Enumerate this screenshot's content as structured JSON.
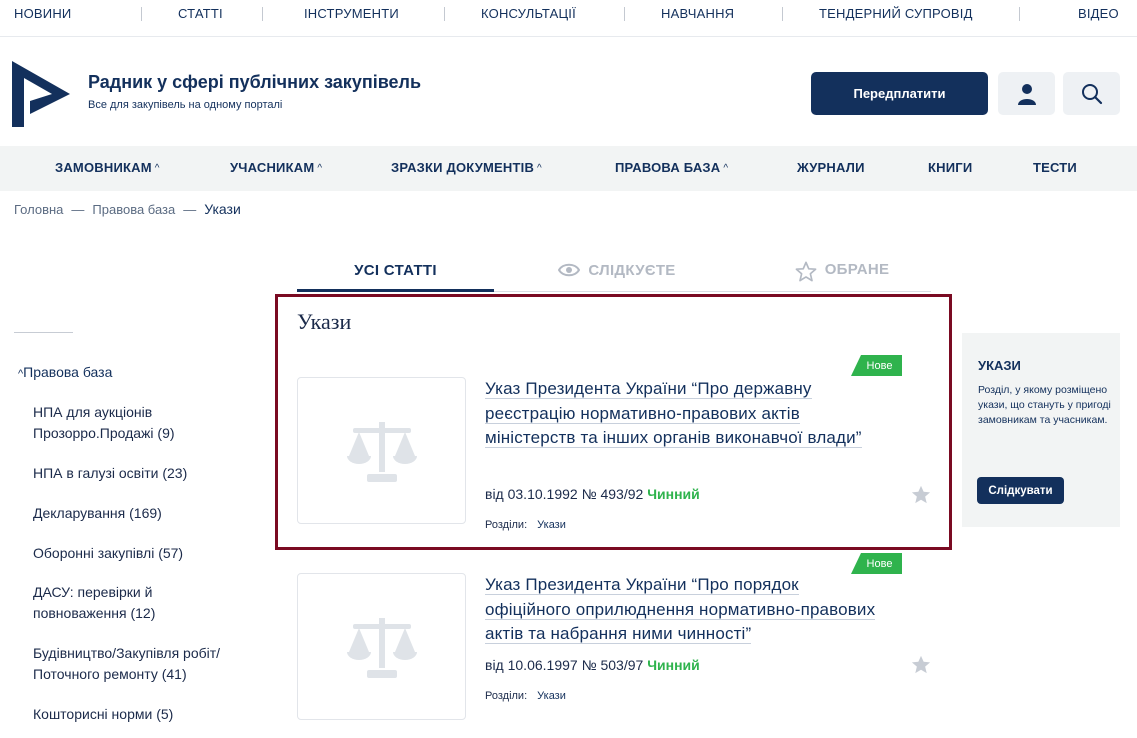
{
  "top_nav": [
    "НОВИНИ",
    "СТАТТІ",
    "ІНСТРУМЕНТИ",
    "КОНСУЛЬТАЦІЇ",
    "НАВЧАННЯ",
    "ТЕНДЕРНИЙ СУПРОВІД",
    "ВІДЕО"
  ],
  "header": {
    "title": "Радник у сфері публічних закупівель",
    "subtitle": "Все для закупівель на одному порталі",
    "subscribe_label": "Передплатити",
    "user_icon": "user-icon",
    "search_icon": "search-icon"
  },
  "main_menu": [
    "ЗАМОВНИКАМ",
    "УЧАСНИКАМ",
    "ЗРАЗКИ ДОКУМЕНТІВ",
    "ПРАВОВА БАЗА",
    "ЖУРНАЛИ",
    "КНИГИ",
    "ТЕСТИ"
  ],
  "breadcrumb": {
    "home": "Головна",
    "level1": "Правова база",
    "current": "Укази",
    "separator": "—"
  },
  "tabs": {
    "all": "УСІ СТАТТІ",
    "following": "СЛІДКУЄТЕ",
    "favorites": "ОБРАНЕ"
  },
  "sidebar": {
    "head": "Правова база",
    "items": [
      "НПА для аукціонів Прозорро.Продажі (9)",
      "НПА в галузі освіти (23)",
      "Декларування (169)",
      "Оборонні закупівлі (57)",
      "ДАСУ: перевірки й повноваження (12)",
      "Будівництво/Закупівля робіт/ Поточного ремонту (41)",
      "Кошторисні норми (5)"
    ]
  },
  "section_title": "Укази",
  "articles": [
    {
      "badge": "Нове",
      "title": "Указ Президента України “Про державну реєстрацію нормативно-правових актів міністерств та інших органів виконавчої влади”",
      "meta": "від 03.10.1992 № 493/92",
      "status": "Чинний",
      "sections_label": "Розділи:",
      "section": "Укази"
    },
    {
      "badge": "Нове",
      "title": "Указ Президента України “Про порядок офіційного оприлюднення нормативно-правових актів та набрання ними чинності”",
      "meta": "від 10.06.1997 № 503/97",
      "status": "Чинний",
      "sections_label": "Розділи:",
      "section": "Укази"
    }
  ],
  "right_panel": {
    "title": "УКАЗИ",
    "text": "Розділ, у якому розміщено укази, що стануть у пригоді замовникам та учасникам.",
    "button": "Слідкувати"
  },
  "colors": {
    "brand": "#13305c",
    "status_green": "#2fb34d",
    "highlight": "#7a0a22",
    "menu_bg": "#f2f4f4"
  }
}
